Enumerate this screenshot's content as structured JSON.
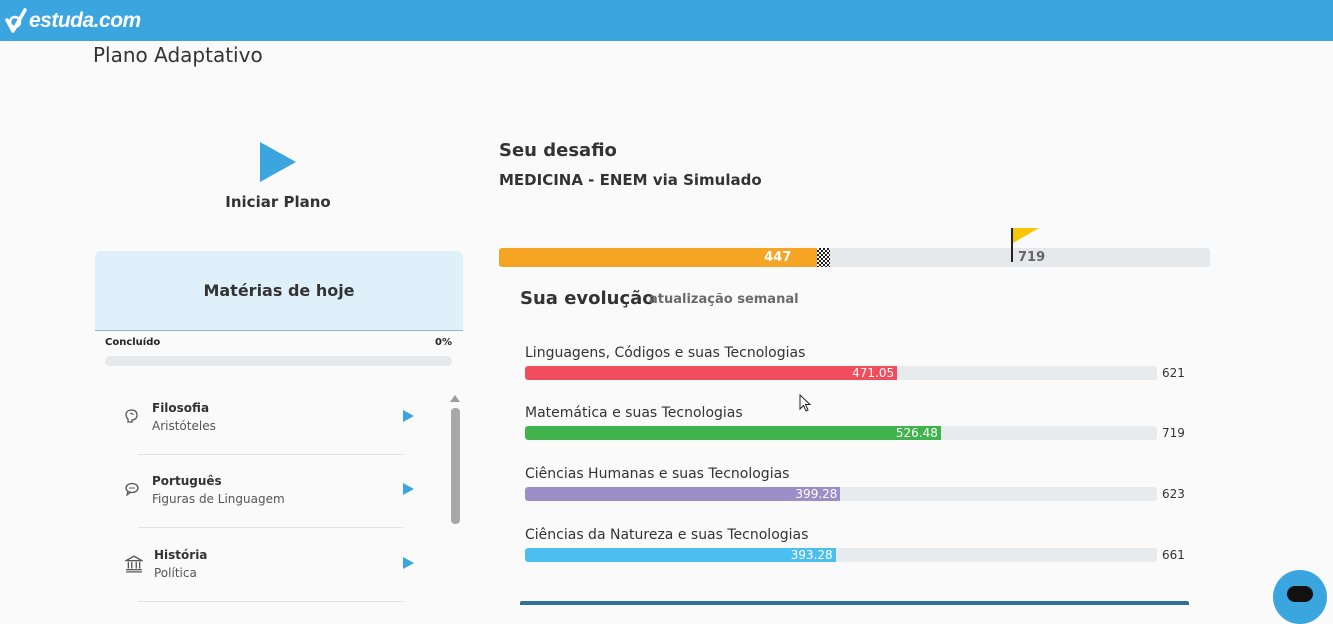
{
  "header": {
    "logo_text": "estuda.com",
    "brand_color": "#3ba5e0"
  },
  "page_title": "Plano Adaptativo",
  "start_plan": {
    "label": "Iniciar Plano",
    "icon": "play-icon"
  },
  "today": {
    "title": "Matérias de hoje",
    "done_label": "Concluído",
    "done_pct": "0%",
    "done_fraction": 0,
    "subjects": [
      {
        "name": "Filosofia",
        "topic": "Aristóteles",
        "icon": "brain-icon"
      },
      {
        "name": "Português",
        "topic": "Figuras de Linguagem",
        "icon": "speech-bubble-icon"
      },
      {
        "name": "História",
        "topic": "Política",
        "icon": "museum-icon"
      }
    ]
  },
  "challenge": {
    "heading": "Seu desafio",
    "subtitle": "MEDICINA - ENEM via Simulado",
    "current": "447",
    "goal": "719",
    "current_value": 447,
    "goal_value": 719
  },
  "evolution": {
    "heading": "Sua evolução",
    "subheading": "atualização semanal",
    "areas": [
      {
        "name": "Linguagens, Códigos e suas Tecnologias",
        "value": "471.05",
        "goal": "621",
        "score": 471.05,
        "color": "#f14d5c"
      },
      {
        "name": "Matemática e suas Tecnologias",
        "value": "526.48",
        "goal": "719",
        "score": 526.48,
        "color": "#41b34d"
      },
      {
        "name": "Ciências Humanas e suas Tecnologias",
        "value": "399.28",
        "goal": "623",
        "score": 399.28,
        "color": "#9b8fc7"
      },
      {
        "name": "Ciências da Natureza e suas Tecnologias",
        "value": "393.28",
        "goal": "661",
        "score": 393.28,
        "color": "#4bbff0"
      }
    ]
  },
  "colors": {
    "accent": "#3ba5e0",
    "challenge_bar": "#f5a523",
    "flag": "#f7c600"
  }
}
